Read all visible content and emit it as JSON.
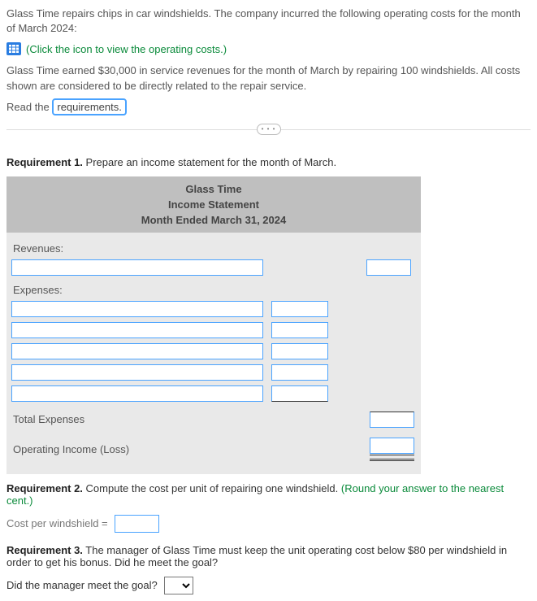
{
  "intro1": "Glass Time repairs chips in car windshields. The company incurred the following operating costs for the month of March 2024:",
  "view_costs_link": "(Click the icon to view the operating costs.)",
  "intro2": "Glass Time earned $30,000 in service revenues for the month of March by repairing 100 windshields. All costs shown are considered to be directly related to the repair service.",
  "read_the": "Read the ",
  "requirements_link": "requirements.",
  "ellipsis": "• • •",
  "req1": {
    "label": "Requirement 1.",
    "text": " Prepare an income statement for the month of March."
  },
  "statement": {
    "company": "Glass Time",
    "title": "Income Statement",
    "period": "Month Ended March 31, 2024",
    "revenues_label": "Revenues:",
    "expenses_label": "Expenses:",
    "total_expenses_label": "Total Expenses",
    "operating_income_label": "Operating Income (Loss)"
  },
  "req2": {
    "label": "Requirement 2.",
    "text": " Compute the cost per unit of repairing one windshield. ",
    "hint": "(Round your answer to the nearest cent.)",
    "cost_label": "Cost per windshield ="
  },
  "req3": {
    "label": "Requirement 3.",
    "text": " The manager of Glass Time must keep the unit operating cost below $80 per windshield in order to get his bonus. Did he meet the goal?",
    "question": "Did the manager meet the goal?"
  }
}
